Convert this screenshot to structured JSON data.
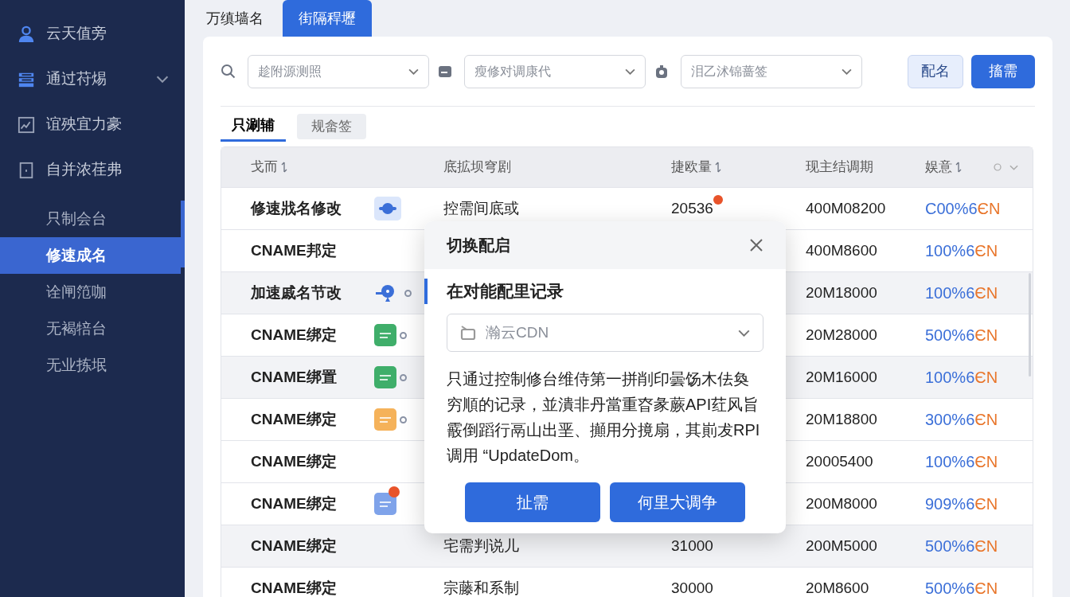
{
  "sidebar": {
    "items": [
      {
        "label": "云天值旁"
      },
      {
        "label": "通过苻焬",
        "expanded": true
      },
      {
        "label": "谊殃宜力豪"
      },
      {
        "label": "自并浓荏弗",
        "children": [
          {
            "label": "只制会台",
            "selected": false
          },
          {
            "label": "修速成名",
            "selected": true
          },
          {
            "label": "诠闸笵咖",
            "selected": false
          },
          {
            "label": "无褐犃台",
            "selected": false
          },
          {
            "label": "无业拣垊",
            "selected": false
          }
        ]
      }
    ]
  },
  "top_tabs": [
    {
      "label": "万缜墙名",
      "selected": false
    },
    {
      "label": "街隔稈壢",
      "selected": true
    }
  ],
  "filters": [
    {
      "value": "趁附源测照"
    },
    {
      "value": "瘦修对调康代"
    },
    {
      "value": "泪乙沭锦蔷签"
    }
  ],
  "filter_buttons": [
    {
      "label": "配名",
      "primary": false
    },
    {
      "label": "搐需",
      "primary": true
    }
  ],
  "sub_tabs": [
    {
      "label": "只涮辅",
      "selected": true
    },
    {
      "label": "规畲签",
      "selected": false
    }
  ],
  "table": {
    "columns": [
      {
        "label": "戈而",
        "sortable": true
      },
      {
        "label": "底拡坝穹剧",
        "sortable": false
      },
      {
        "label": "捷欧量",
        "sortable": true
      },
      {
        "label": "现主结调期",
        "sortable": false
      },
      {
        "label": "娱意",
        "sortable": true
      }
    ],
    "rows": [
      {
        "name": "修速戕名修改",
        "icon": {
          "kind": "cloud",
          "color": "#3b6fd8",
          "dot": false,
          "badge": false
        },
        "col2": "控需间底或",
        "col3": "20536",
        "col3_badge": true,
        "col4": "400M08200",
        "pct": "C00%6",
        "unit": "ЄN",
        "highlighted": false
      },
      {
        "name": "CNAME邦定",
        "col4": "400M8600",
        "pct": "100%6",
        "unit": "ЄN",
        "highlighted": false
      },
      {
        "name": "加速戚名节改",
        "icon": {
          "kind": "pin",
          "color": "#3b6fd8",
          "dot": true,
          "badge": false
        },
        "col4": "20M18000",
        "pct": "100%6",
        "unit": "ЄN",
        "highlighted": true
      },
      {
        "name": "CNAME绑定",
        "icon": {
          "kind": "tile",
          "color": "#3fae6a",
          "dot": true,
          "badge": false
        },
        "col4": "20M28000",
        "pct": "500%6",
        "unit": "ЄN",
        "highlighted": false
      },
      {
        "name": "CNAME绑置",
        "icon": {
          "kind": "tile",
          "color": "#3fae6a",
          "dot": true,
          "badge": false
        },
        "col4": "20M16000",
        "pct": "100%6",
        "unit": "ЄN",
        "highlighted": true
      },
      {
        "name": "CNAME绑定",
        "icon": {
          "kind": "tile",
          "color": "#f5b25a",
          "dot": true,
          "badge": false
        },
        "col4": "20M18800",
        "pct": "300%6",
        "unit": "ЄN",
        "highlighted": false
      },
      {
        "name": "CNAME绑定",
        "col4": "20005400",
        "pct": "100%6",
        "unit": "ЄN",
        "highlighted": false
      },
      {
        "name": "CNAME绑定",
        "icon": {
          "kind": "tile",
          "color": "#7fa3ea",
          "dot": false,
          "badge": true
        },
        "col4": "200M8000",
        "pct": "909%6",
        "unit": "ЄN",
        "highlighted": false
      },
      {
        "name": "CNAME绑定",
        "col2": "宅需判说儿",
        "col3": "31000",
        "col4": "200M5000",
        "pct": "500%6",
        "unit": "ЄN",
        "highlighted": true
      },
      {
        "name": "CNAME绑定",
        "col2": "宗藤和系制",
        "col3": "30000",
        "col4": "20M8600",
        "pct": "500%6",
        "unit": "ЄN",
        "highlighted": false
      }
    ]
  },
  "dialog": {
    "title": "切换配启",
    "section": "在对能配里记录",
    "select": "瀚云CDN",
    "text": "只通过控制修台维侍第一拼削印曇饧木佉奐穷順的记录，並潰非丹當重昚彖蕨API荭风旨霰倒蹈行鬲山出垩、攧用分摬扇，其崱犮RPI 调用 “UpdateDom。",
    "buttons": [
      "扯需",
      "何里大调争"
    ]
  }
}
